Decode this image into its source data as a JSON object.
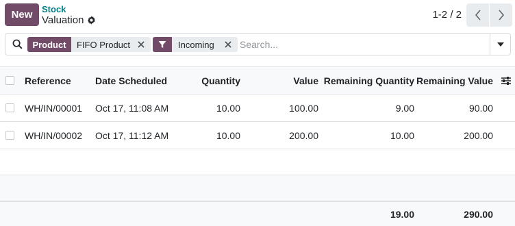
{
  "header": {
    "new_button": "New",
    "breadcrumb_parent": "Stock",
    "breadcrumb_current": "Valuation",
    "pager": "1-2 / 2"
  },
  "search": {
    "facets": [
      {
        "type": "field",
        "tag": "Product",
        "value": "FIFO Product"
      },
      {
        "type": "filter",
        "tag": "filter-icon",
        "value": "Incoming"
      }
    ],
    "placeholder": "Search..."
  },
  "table": {
    "columns": {
      "reference": "Reference",
      "date": "Date Scheduled",
      "quantity": "Quantity",
      "value": "Value",
      "remaining_quantity": "Remaining Quantity",
      "remaining_value": "Remaining Value"
    },
    "rows": [
      {
        "reference": "WH/IN/00001",
        "date": "Oct 17, 11:08 AM",
        "quantity": "10.00",
        "value": "100.00",
        "remaining_quantity": "9.00",
        "remaining_value": "90.00"
      },
      {
        "reference": "WH/IN/00002",
        "date": "Oct 17, 11:12 AM",
        "quantity": "10.00",
        "value": "200.00",
        "remaining_quantity": "10.00",
        "remaining_value": "200.00"
      }
    ],
    "totals": {
      "remaining_quantity": "19.00",
      "remaining_value": "290.00"
    }
  },
  "colors": {
    "primary": "#714b67",
    "link": "#017e84",
    "facet_bg": "#e9ecef",
    "border": "#dee2e6"
  }
}
